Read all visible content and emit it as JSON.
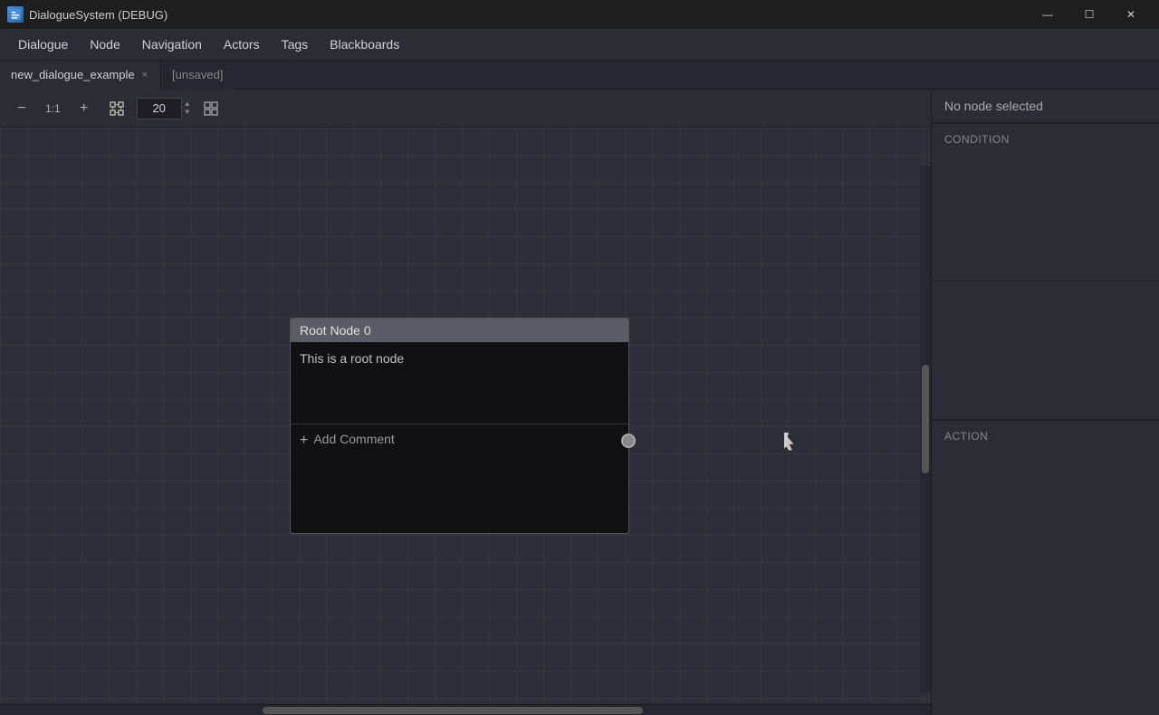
{
  "titlebar": {
    "app_name": "DialogueSystem (DEBUG)",
    "icon_text": "D"
  },
  "window_controls": {
    "minimize": "—",
    "maximize": "☐",
    "close": "✕"
  },
  "menubar": {
    "items": [
      {
        "id": "dialogue",
        "label": "Dialogue"
      },
      {
        "id": "node",
        "label": "Node"
      },
      {
        "id": "navigation",
        "label": "Navigation"
      },
      {
        "id": "actors",
        "label": "Actors"
      },
      {
        "id": "tags",
        "label": "Tags"
      },
      {
        "id": "blackboards",
        "label": "Blackboards"
      }
    ]
  },
  "tabs": {
    "active": {
      "label": "new_dialogue_example",
      "close": "×"
    },
    "unsaved": "[unsaved]"
  },
  "toolbar": {
    "zoom_out": "−",
    "zoom_reset": "1:1",
    "zoom_in": "+",
    "fit": "⊞",
    "zoom_value": "20",
    "grid": "⊟"
  },
  "canvas": {
    "bg_color": "#2d2f38"
  },
  "node": {
    "title": "Root Node 0",
    "body_text": "This is a root node",
    "add_comment_label": "+ Add Comment"
  },
  "right_panel": {
    "header": "No node selected",
    "condition_label": "CONDITION",
    "action_label": "ACTION"
  }
}
